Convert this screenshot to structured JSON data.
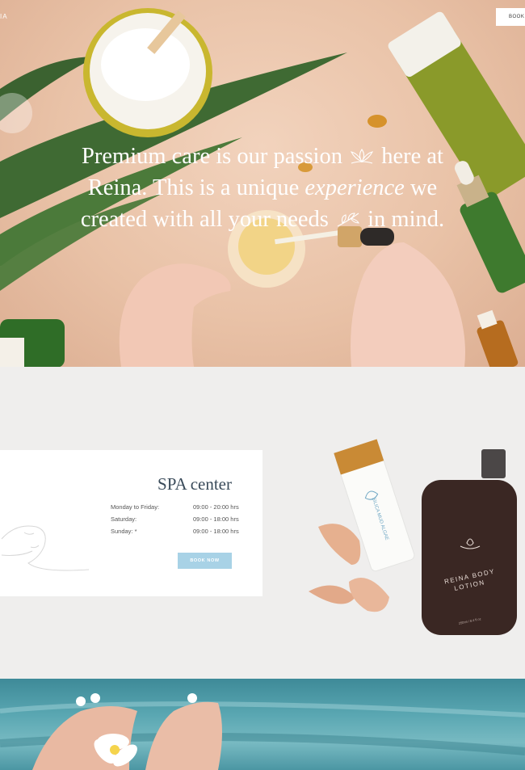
{
  "header": {
    "brand_fragment": "IA",
    "book_button_label": "BOOK"
  },
  "hero": {
    "line1_a": "Premium care is our passion",
    "line1_b": "here at",
    "line2_a": "Reina. This is a unique",
    "line2_em": "experience",
    "line2_b": "we",
    "line3_a": "created with all your needs",
    "line3_b": "in mind."
  },
  "spa": {
    "title": "SPA center",
    "hours": [
      {
        "day": "Monday to Friday:",
        "time": "09:00 - 20:00 hrs"
      },
      {
        "day": "Saturday:",
        "time": "09:00 - 18:00 hrs"
      },
      {
        "day": "Sunday: *",
        "time": "09:00 - 18:00 hrs"
      }
    ],
    "book_now_label": "BOOK NOW"
  },
  "products": {
    "tube_label": "SILICA MUD ALGAE",
    "bottle_label_line1": "REINA BODY",
    "bottle_label_line2": "LOTION",
    "bottle_volume": "250ml / 8.4 fl oz"
  },
  "colors": {
    "hero_background": "#e9c2a7",
    "spa_background": "#efeeed",
    "book_now_button": "#a8d2e6",
    "bottle": "#3a2723",
    "pool_water": "#5aa7b2"
  },
  "icons": [
    "lotus-icon",
    "leaf-sprig-icon",
    "lotus-logo-icon"
  ]
}
